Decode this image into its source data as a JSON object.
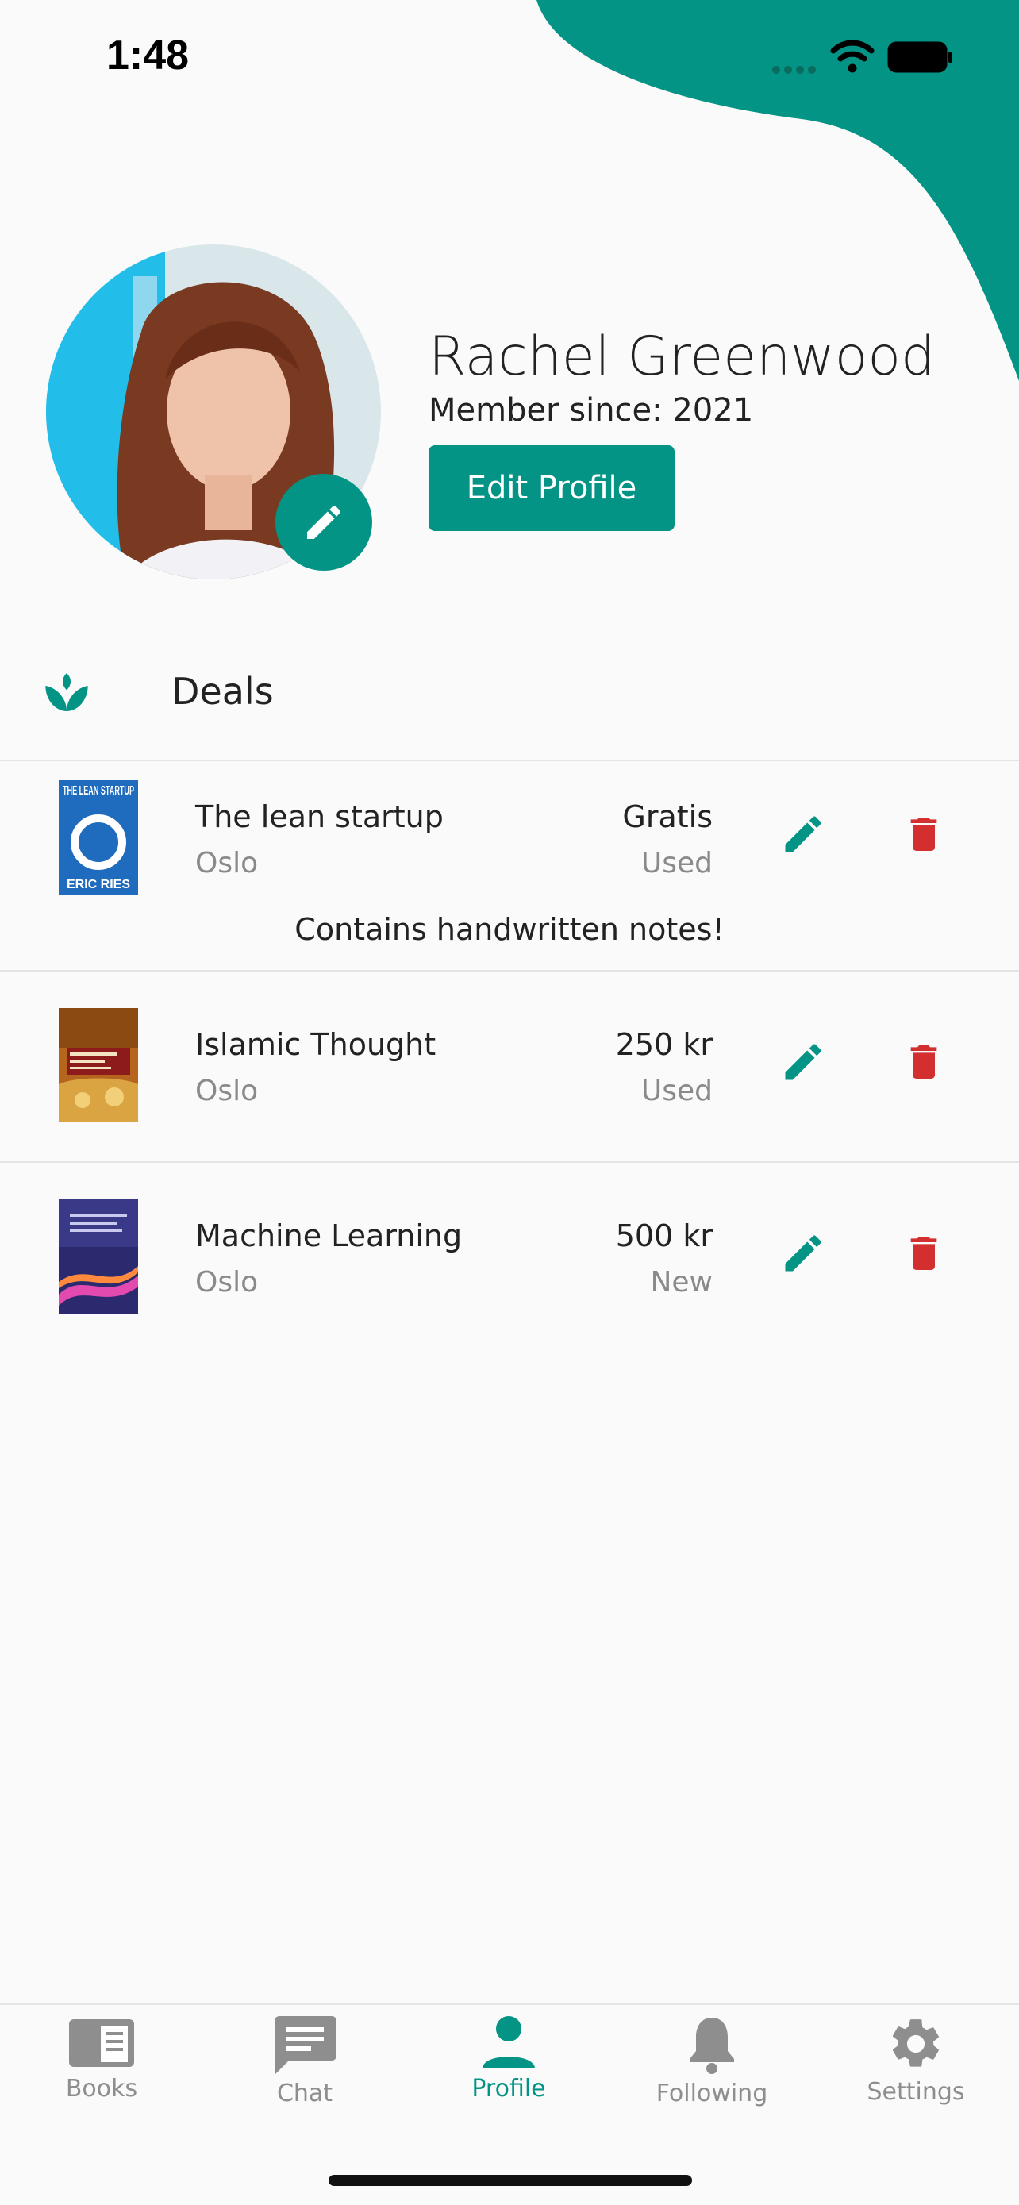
{
  "status_bar": {
    "time": "1:48"
  },
  "profile": {
    "name": "Rachel Greenwood",
    "member_since": "Member since: 2021",
    "edit_profile_label": "Edit Profile"
  },
  "deals": {
    "title": "Deals",
    "items": [
      {
        "title": "The lean startup",
        "location": "Oslo",
        "price": "Gratis",
        "condition": "Used",
        "note": "Contains handwritten notes!",
        "cover": {
          "top_text": "THE LEAN STARTUP",
          "bottom_text": "ERIC RIES"
        }
      },
      {
        "title": "Islamic Thought",
        "location": "Oslo",
        "price": "250 kr",
        "condition": "Used",
        "note": ""
      },
      {
        "title": "Machine Learning",
        "location": "Oslo",
        "price": "500 kr",
        "condition": "New",
        "note": ""
      }
    ]
  },
  "bottom_nav": {
    "items": [
      {
        "label": "Books",
        "icon": "book-icon"
      },
      {
        "label": "Chat",
        "icon": "chat-icon"
      },
      {
        "label": "Profile",
        "icon": "person-icon"
      },
      {
        "label": "Following",
        "icon": "bell-icon"
      },
      {
        "label": "Settings",
        "icon": "gear-icon"
      }
    ],
    "active_index": 2
  },
  "colors": {
    "accent": "#039485",
    "delete": "#d32f2f",
    "inactive": "#8e8e8e",
    "background": "#fafafa"
  }
}
